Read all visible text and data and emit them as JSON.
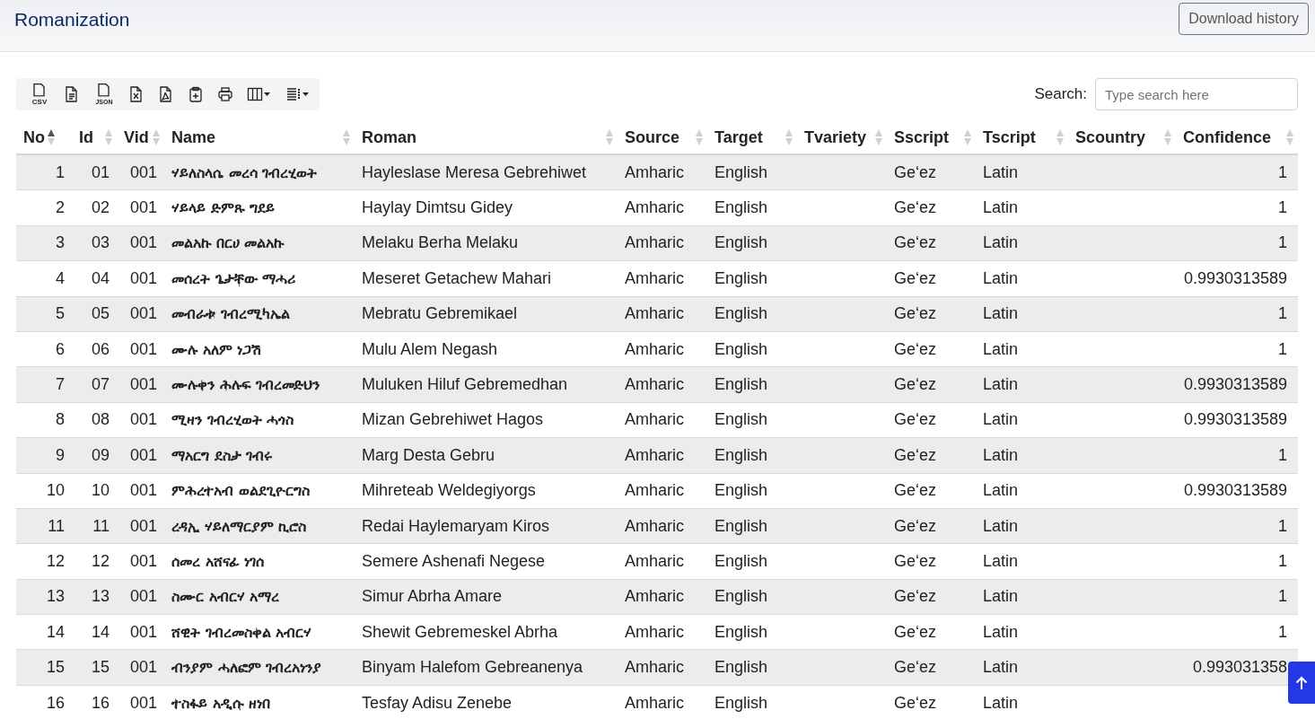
{
  "header": {
    "title": "Romanization",
    "download_button": "Download history"
  },
  "toolbar": [
    {
      "kind": "csv",
      "label": "CSV"
    },
    {
      "kind": "text"
    },
    {
      "kind": "json",
      "label": "JSON"
    },
    {
      "kind": "excel"
    },
    {
      "kind": "pdf"
    },
    {
      "kind": "clipboard"
    },
    {
      "kind": "print"
    },
    {
      "kind": "columns"
    },
    {
      "kind": "rows"
    }
  ],
  "search": {
    "label": "Search:",
    "placeholder": "Type search here"
  },
  "table": {
    "columns": [
      {
        "label": "No",
        "kind": "number",
        "sorted": true
      },
      {
        "label": "Id",
        "kind": "number",
        "sorted": false
      },
      {
        "label": "Vid",
        "kind": "number",
        "sorted": false
      },
      {
        "label": "Name",
        "kind": "ethiopic",
        "sorted": false
      },
      {
        "label": "Roman",
        "kind": "text",
        "sorted": false
      },
      {
        "label": "Source",
        "kind": "text",
        "sorted": false
      },
      {
        "label": "Target",
        "kind": "text",
        "sorted": false
      },
      {
        "label": "Tvariety",
        "kind": "text",
        "sorted": false
      },
      {
        "label": "Sscript",
        "kind": "text",
        "sorted": false
      },
      {
        "label": "Tscript",
        "kind": "text",
        "sorted": false
      },
      {
        "label": "Scountry",
        "kind": "text",
        "sorted": false
      },
      {
        "label": "Confidence",
        "kind": "number",
        "sorted": false
      }
    ],
    "rows": [
      {
        "no": "1",
        "id": "01",
        "vid": "001",
        "name": "ሃይለስላሴ መረሳ ገብረሂወት",
        "roman": "Hayleslase Meresa Gebrehiwet",
        "source": "Amharic",
        "target": "English",
        "sscript": "Ge‘ez",
        "tscript": "Latin",
        "confidence": "1"
      },
      {
        "no": "2",
        "id": "02",
        "vid": "001",
        "name": "ሃይላይ ድምጹ ግደይ",
        "roman": "Haylay Dimtsu Gidey",
        "source": "Amharic",
        "target": "English",
        "sscript": "Ge‘ez",
        "tscript": "Latin",
        "confidence": "1"
      },
      {
        "no": "3",
        "id": "03",
        "vid": "001",
        "name": "መልአኩ በርሀ መልአኩ",
        "roman": "Melaku Berha Melaku",
        "source": "Amharic",
        "target": "English",
        "sscript": "Ge‘ez",
        "tscript": "Latin",
        "confidence": "1"
      },
      {
        "no": "4",
        "id": "04",
        "vid": "001",
        "name": "መሰረት ጌታቸው ማሓሪ",
        "roman": "Meseret Getachew Mahari",
        "source": "Amharic",
        "target": "English",
        "sscript": "Ge‘ez",
        "tscript": "Latin",
        "confidence": "0.9930313589"
      },
      {
        "no": "5",
        "id": "05",
        "vid": "001",
        "name": "መብራቱ ገብረሚካኤል",
        "roman": "Mebratu Gebremikael",
        "source": "Amharic",
        "target": "English",
        "sscript": "Ge‘ez",
        "tscript": "Latin",
        "confidence": "1"
      },
      {
        "no": "6",
        "id": "06",
        "vid": "001",
        "name": "ሙሉ አለም ነጋሽ",
        "roman": "Mulu Alem Negash",
        "source": "Amharic",
        "target": "English",
        "sscript": "Ge‘ez",
        "tscript": "Latin",
        "confidence": "1"
      },
      {
        "no": "7",
        "id": "07",
        "vid": "001",
        "name": "ሙሉቀን ሕሉፍ ገብረመድህን",
        "roman": "Muluken Hiluf Gebremedhan",
        "source": "Amharic",
        "target": "English",
        "sscript": "Ge‘ez",
        "tscript": "Latin",
        "confidence": "0.9930313589"
      },
      {
        "no": "8",
        "id": "08",
        "vid": "001",
        "name": "ሚዛን ገብረሂወት ሓጎስ",
        "roman": "Mizan Gebrehiwet Hagos",
        "source": "Amharic",
        "target": "English",
        "sscript": "Ge‘ez",
        "tscript": "Latin",
        "confidence": "0.9930313589"
      },
      {
        "no": "9",
        "id": "09",
        "vid": "001",
        "name": "ማአርግ ደስታ ገብሩ",
        "roman": "Marg Desta Gebru",
        "source": "Amharic",
        "target": "English",
        "sscript": "Ge‘ez",
        "tscript": "Latin",
        "confidence": "1"
      },
      {
        "no": "10",
        "id": "10",
        "vid": "001",
        "name": "ምሕረተአብ ወልደጊዮርግስ",
        "roman": "Mihreteab Weldegiyorgs",
        "source": "Amharic",
        "target": "English",
        "sscript": "Ge‘ez",
        "tscript": "Latin",
        "confidence": "0.9930313589"
      },
      {
        "no": "11",
        "id": "11",
        "vid": "001",
        "name": "ረዳኢ ሃይለማርያም ኪሮስ",
        "roman": "Redai Haylemaryam Kiros",
        "source": "Amharic",
        "target": "English",
        "sscript": "Ge‘ez",
        "tscript": "Latin",
        "confidence": "1"
      },
      {
        "no": "12",
        "id": "12",
        "vid": "001",
        "name": "ሰመረ አሸናፊ ነገሰ",
        "roman": "Semere Ashenafi Negese",
        "source": "Amharic",
        "target": "English",
        "sscript": "Ge‘ez",
        "tscript": "Latin",
        "confidence": "1"
      },
      {
        "no": "13",
        "id": "13",
        "vid": "001",
        "name": "ስሙር አብርሃ አማረ",
        "roman": "Simur Abrha Amare",
        "source": "Amharic",
        "target": "English",
        "sscript": "Ge‘ez",
        "tscript": "Latin",
        "confidence": "1"
      },
      {
        "no": "14",
        "id": "14",
        "vid": "001",
        "name": "ሸዊት ገብረመስቀል አብርሃ",
        "roman": "Shewit Gebremeskel Abrha",
        "source": "Amharic",
        "target": "English",
        "sscript": "Ge‘ez",
        "tscript": "Latin",
        "confidence": "1"
      },
      {
        "no": "15",
        "id": "15",
        "vid": "001",
        "name": "ብንያም ሓለፎም ገብረአነንያ",
        "roman": "Binyam Halefom Gebreanenya",
        "source": "Amharic",
        "target": "English",
        "sscript": "Ge‘ez",
        "tscript": "Latin",
        "confidence": "0.993031358"
      },
      {
        "no": "16",
        "id": "16",
        "vid": "001",
        "name": "ተስፋይ አዲሱ ዘነበ",
        "roman": "Tesfay Adisu Zenebe",
        "source": "Amharic",
        "target": "English",
        "sscript": "Ge‘ez",
        "tscript": "Latin"
      }
    ]
  }
}
